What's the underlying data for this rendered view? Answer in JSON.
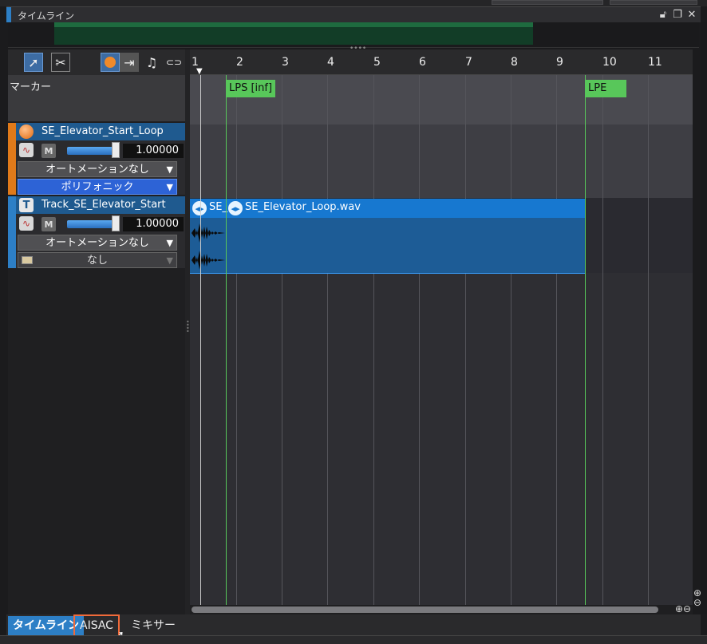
{
  "window": {
    "title": "タイムライン",
    "title_icons": [
      "lock-icon",
      "restore-icon",
      "close-icon"
    ]
  },
  "toolbar": {
    "tools": [
      {
        "name": "select-tool-icon",
        "glyph": "➚",
        "selected": true
      },
      {
        "name": "split-tool-icon",
        "glyph": "✂",
        "selected": false
      },
      {
        "name": "record-icon",
        "glyph": "●",
        "selected": true
      },
      {
        "name": "arrow-right-icon",
        "glyph": "⇥",
        "selected": false
      },
      {
        "name": "music-note-icon",
        "glyph": "♫",
        "selected": false
      },
      {
        "name": "link-icon",
        "glyph": "⊂⊃",
        "selected": false
      }
    ]
  },
  "marker": {
    "label": "マーカー"
  },
  "tracks": [
    {
      "name": "SE_Elevator_Start_Loop",
      "stripe_color": "#e07a1a",
      "icon_color": "#f08a2a",
      "volume": "1.00000",
      "mute": "M",
      "automation": "オートメーションなし",
      "mode": "ポリフォニック"
    },
    {
      "name": "Track_SE_Elevator_Start",
      "stripe_color": "#2d7fc6",
      "icon_label": "T",
      "volume": "1.00000",
      "mute": "M",
      "automation": "オートメーションなし",
      "mode": "なし"
    }
  ],
  "ruler": {
    "ticks": [
      "1",
      "2",
      "3",
      "4",
      "5",
      "6",
      "7",
      "8",
      "9",
      "10",
      "11"
    ]
  },
  "loop_markers": {
    "start": "LPS [inf]",
    "end": "LPE"
  },
  "clips": [
    {
      "label": "SE_"
    },
    {
      "label": "SE_Elevator_Loop.wav"
    }
  ],
  "zoom": {
    "plus": "⊕",
    "minus": "⊖"
  },
  "tabs": [
    {
      "label": "タイムライン",
      "active": true
    },
    {
      "label": "AISAC",
      "active": false,
      "highlight": true
    },
    {
      "label": "ミキサー",
      "active": false
    }
  ],
  "colors": {
    "accent": "#2d7fc6",
    "loop_green": "#58c75a",
    "clip_blue": "#1778d0",
    "highlight": "#f06a3a"
  }
}
